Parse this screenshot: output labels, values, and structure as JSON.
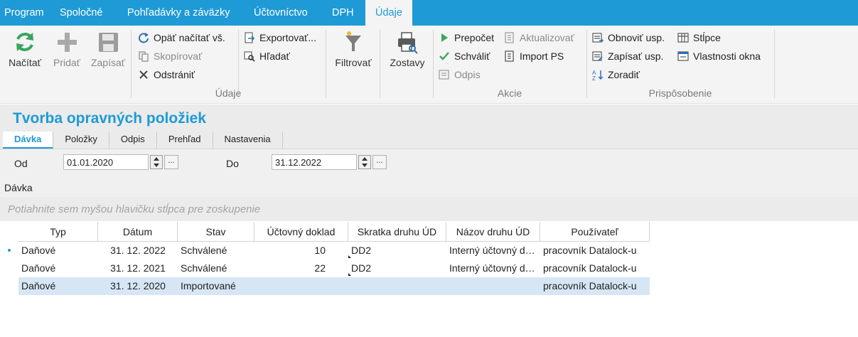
{
  "menu": {
    "items": [
      "Program",
      "Spoločné",
      "Pohľadávky a záväzky",
      "Účtovníctvo",
      "DPH",
      "Údaje"
    ],
    "active": "Údaje"
  },
  "ribbon": {
    "nacitat": "Načítať",
    "pridat": "Pridať",
    "zapisat": "Zapísať",
    "opat_nacitat": "Opäť načítať vš.",
    "skopirovat": "Skopírovať",
    "odstranit": "Odstrániť",
    "exportovat": "Exportovať...",
    "hladat": "Hľadať",
    "filtrovat": "Filtrovať",
    "zostavy": "Zostavy",
    "prepocet": "Prepočet",
    "schvalit": "Schváliť",
    "odpis": "Odpis",
    "aktualizovat": "Aktualizovať",
    "import_ps": "Import PS",
    "obnovit_usp": "Obnoviť usp.",
    "zapisat_usp": "Zapísať usp.",
    "zoradit": "Zoradiť",
    "stlpce": "Stĺpce",
    "vlastnosti_okna": "Vlastnosti okna",
    "group_udaje": "Údaje",
    "group_akcie": "Akcie",
    "group_prisposobenie": "Prispôsobenie"
  },
  "page": {
    "title": "Tvorba opravných položiek",
    "tabs": [
      "Dávka",
      "Položky",
      "Odpis",
      "Prehľad",
      "Nastavenia"
    ]
  },
  "filter": {
    "od_label": "Od",
    "od_value": "01.01.2020",
    "do_label": "Do",
    "do_value": "31.12.2022",
    "dots": "..."
  },
  "section": {
    "label": "Dávka",
    "group_hint": "Potiahnite sem myšou hlavičku stĺpca pre zoskupenie"
  },
  "grid": {
    "columns": [
      "Typ",
      "Dátum",
      "Stav",
      "Účtovný doklad",
      "Skratka druhu ÚD",
      "Názov druhu ÚD",
      "Používateľ"
    ],
    "rows": [
      [
        "Daňové",
        "31. 12. 2022",
        "Schválené",
        "10",
        "DD2",
        "Interný účtovný doklad",
        "pracovník Datalock-u"
      ],
      [
        "Daňové",
        "31. 12. 2021",
        "Schválené",
        "22",
        "DD2",
        "Interný účtovný doklad",
        "pracovník Datalock-u"
      ],
      [
        "Daňové",
        "31. 12. 2020",
        "Importované",
        "",
        "",
        "",
        "pracovník Datalock-u"
      ]
    ]
  },
  "colors": {
    "accent": "#1e9ad6",
    "selected_row": "#d6e6f4"
  }
}
